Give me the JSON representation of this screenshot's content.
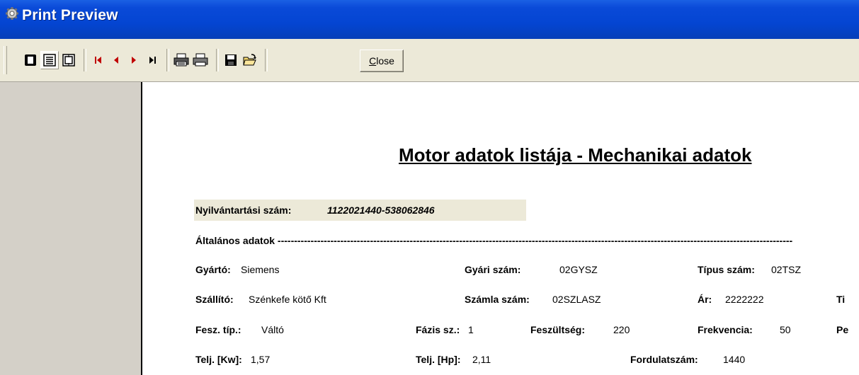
{
  "window": {
    "title": "Print Preview"
  },
  "toolbar": {
    "close_label": "Close"
  },
  "report": {
    "title": "Motor adatok listája - Mechanikai adatok",
    "nyilvantartasi_label": "Nyilvántartási szám:",
    "nyilvantartasi_value": "1122021440-538062846",
    "altalanos_header": "Általános adatok ------------------------------------------------------------------------------------------------------------------------------------------------------------",
    "fields": {
      "gyarto_label": "Gyártó:",
      "gyarto_value": "Siemens",
      "gyari_szam_label": "Gyári szám:",
      "gyari_szam_value": "02GYSZ",
      "tipus_szam_label": "Típus szám:",
      "tipus_szam_value": "02TSZ",
      "szallito_label": "Szállító:",
      "szallito_value": "Szénkefe kötő Kft",
      "szamla_szam_label": "Számla szám:",
      "szamla_szam_value": "02SZLASZ",
      "ar_label": "Ár:",
      "ar_value": "2222222",
      "ti_cut_label": "Ti",
      "fesz_tip_label": "Fesz. típ.:",
      "fesz_tip_value": "Váltó",
      "fazis_label": "Fázis sz.:",
      "fazis_value": "1",
      "feszultseg_label": "Feszültség:",
      "feszultseg_value": "220",
      "frekvencia_label": "Frekvencia:",
      "frekvencia_value": "50",
      "p_cut_label": "Pe",
      "telj_kw_label": "Telj. [Kw]:",
      "telj_kw_value": "1,57",
      "telj_hp_label": "Telj. [Hp]:",
      "telj_hp_value": "2,11",
      "fordulatszam_label": "Fordulatszám:",
      "fordulatszam_value": "1440"
    }
  }
}
